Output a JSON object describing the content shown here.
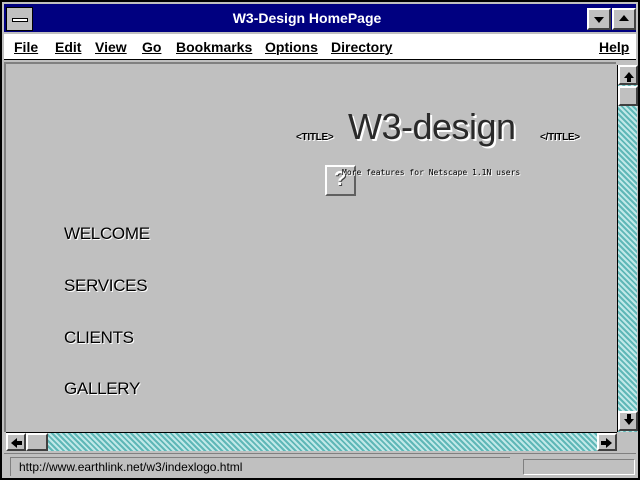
{
  "window": {
    "title": "W3-Design HomePage"
  },
  "menubar": {
    "items": [
      "File",
      "Edit",
      "View",
      "Go",
      "Bookmarks",
      "Options",
      "Directory"
    ],
    "help": "Help"
  },
  "page": {
    "tag_open": "<TITLE>",
    "logo": "W3-design",
    "tag_close": "</TITLE>",
    "broken_image_glyph": "?",
    "subtitle": "More features for Netscape 1.1N users",
    "nav": [
      "WELCOME",
      "SERVICES",
      "CLIENTS",
      "GALLERY"
    ]
  },
  "statusbar": {
    "url": "http://www.earthlink.net/w3/indexlogo.html"
  },
  "icons": {
    "system_menu": "system-menu-icon",
    "minimize": "minimize-triangle-icon",
    "maximize": "maximize-triangle-icon",
    "scroll_up": "arrow-up-icon",
    "scroll_down": "arrow-down-icon",
    "scroll_left": "arrow-left-icon",
    "scroll_right": "arrow-right-icon"
  },
  "colors": {
    "titlebar": "#000080",
    "scroll_track": "#5fb7b7",
    "chrome": "#c0c0c0"
  }
}
